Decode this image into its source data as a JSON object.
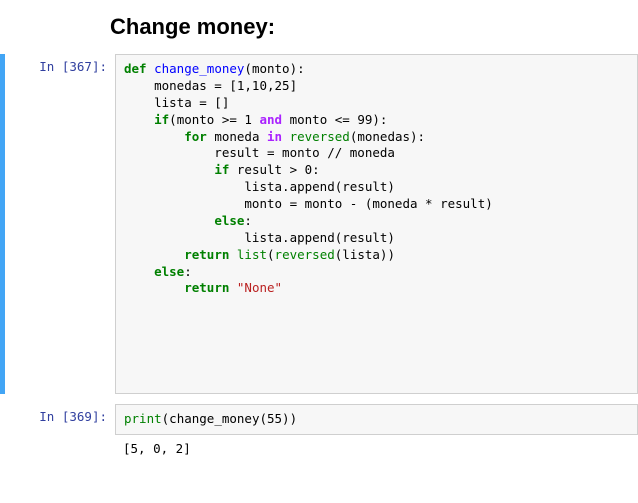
{
  "heading": "Change money:",
  "cell1": {
    "prompt": "In [367]:",
    "code": {
      "l1_kw": "def",
      "l1_fn": "change_money",
      "l1_rest": "(monto):",
      "l2": "    monedas = [1,10,25]",
      "l3": "    lista = []",
      "l4_if": "if",
      "l4_a": "(monto >= 1 ",
      "l4_and": "and",
      "l4_b": " monto <= 99):",
      "l5_for": "for",
      "l5_a": " moneda ",
      "l5_in": "in",
      "l5_b": " ",
      "l5_rev": "reversed",
      "l5_c": "(monedas):",
      "l6": "            result = monto // moneda",
      "l7_if": "if",
      "l7_a": " result > 0:",
      "l8": "                lista.append(result)",
      "l9": "                monto = monto - (moneda * result)",
      "l10_else": "else",
      "l10_c": ":",
      "l11": "                lista.append(result)",
      "l12_ret": "return",
      "l12_a": " ",
      "l12_list": "list",
      "l12_b": "(",
      "l12_rev": "reversed",
      "l12_c": "(lista))",
      "l13_else": "else",
      "l13_c": ":",
      "l14_ret": "return",
      "l14_sp": " ",
      "l14_str": "\"None\""
    }
  },
  "cell2": {
    "prompt": "In [369]:",
    "code": {
      "print": "print",
      "open": "(",
      "fn": "change_money",
      "arg": "(55))"
    }
  },
  "output": "[5, 0, 2]"
}
